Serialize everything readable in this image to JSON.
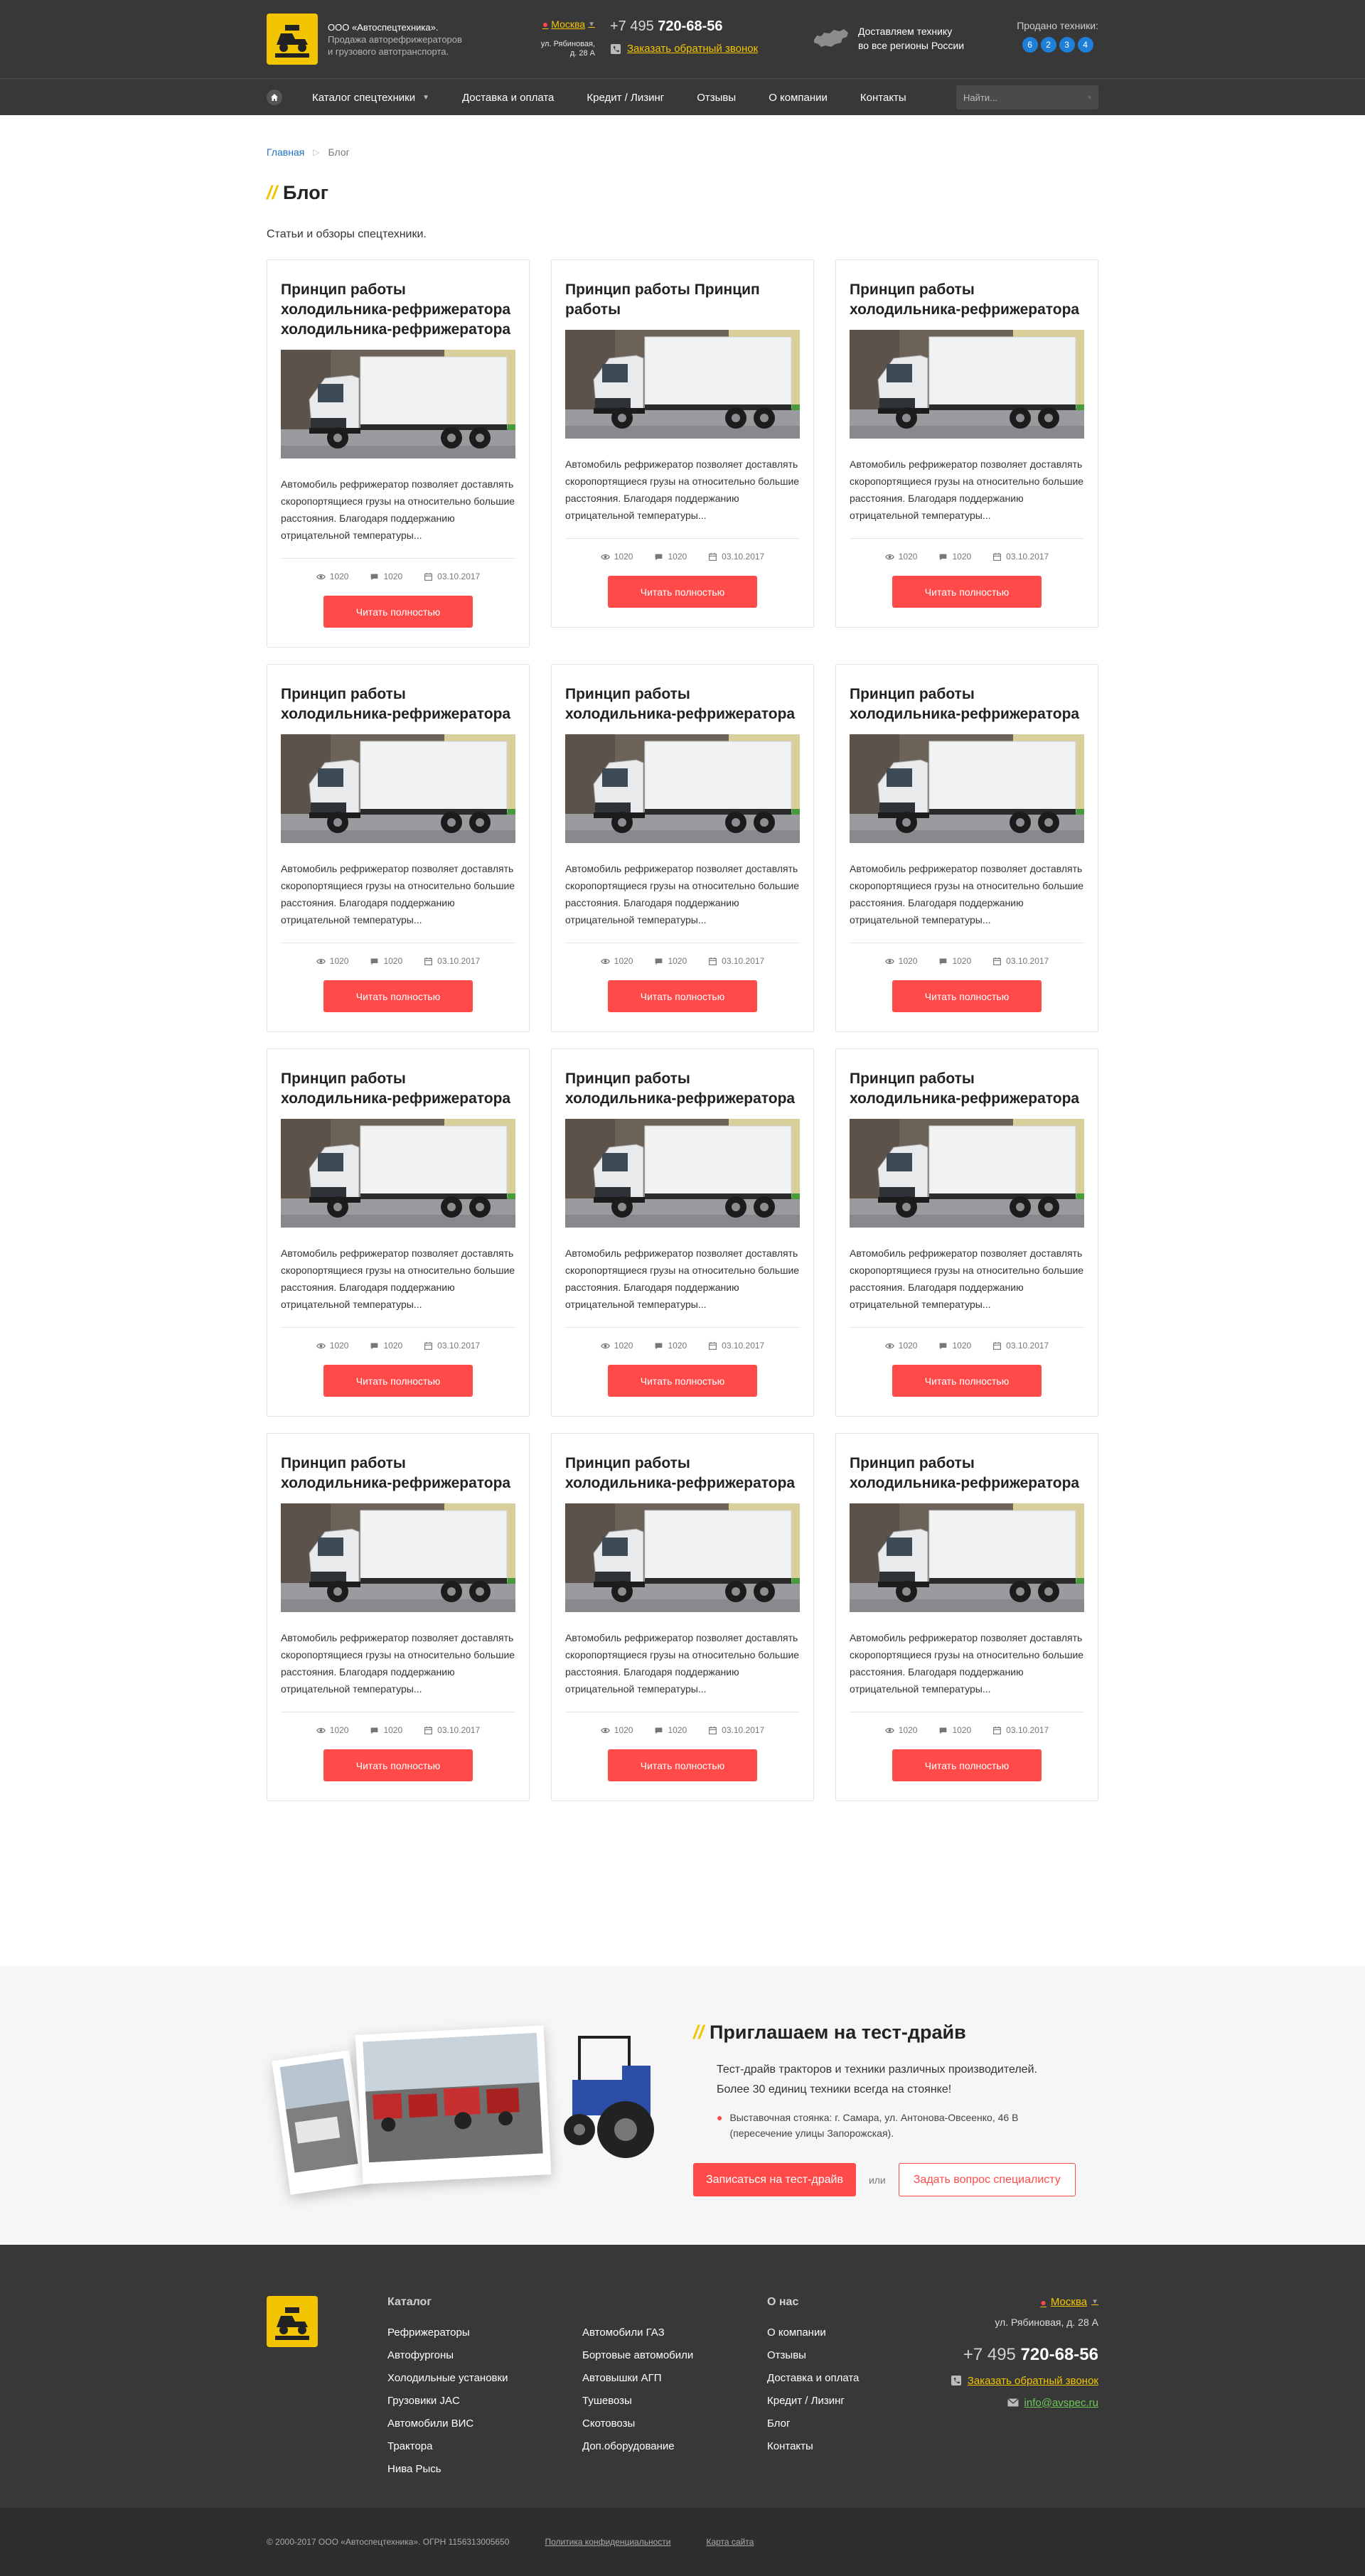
{
  "header": {
    "company_name": "ООО «Автоспецтехника».",
    "company_desc_1": "Продажа авторефрижераторов",
    "company_desc_2": "и грузового автотранспорта.",
    "city": "Москва",
    "address": "ул. Рябиновая, д. 28 А",
    "phone_code": "+7 495",
    "phone_number": "720-68-56",
    "callback": "Заказать обратный звонок",
    "delivery_1": "Доставляем технику",
    "delivery_2": "во все регионы России",
    "sold_label": "Продано техники:",
    "sold_digits": [
      "6",
      "2",
      "3",
      "4"
    ]
  },
  "nav": {
    "items": [
      "Каталог спецтехники",
      "Доставка и оплата",
      "Кредит / Лизинг",
      "Отзывы",
      "О компании",
      "Контакты"
    ],
    "search_placeholder": "Найти..."
  },
  "breadcrumb": {
    "home": "Главная",
    "current": "Блог"
  },
  "page": {
    "title": "Блог",
    "intro": "Статьи и обзоры спецтехники."
  },
  "cards": [
    {
      "title": "Принцип работы холодильника-рефрижератора холодильника-рефрижератора",
      "text": "Автомобиль рефрижератор позволяет доставлять скоропортящиеся грузы на относительно большие расстояния. Благодаря поддержанию отрицательной температуры...",
      "views": "1020",
      "comments": "1020",
      "date": "03.10.2017",
      "button": "Читать полностью"
    },
    {
      "title": "Принцип работы Принцип работы",
      "text": "Автомобиль рефрижератор позволяет доставлять скоропортящиеся грузы на относительно большие расстояния. Благодаря поддержанию отрицательной температуры...",
      "views": "1020",
      "comments": "1020",
      "date": "03.10.2017",
      "button": "Читать полностью"
    },
    {
      "title": "Принцип работы холодильника-рефрижератора",
      "text": "Автомобиль рефрижератор позволяет доставлять скоропортящиеся грузы на относительно большие расстояния. Благодаря поддержанию отрицательной температуры...",
      "views": "1020",
      "comments": "1020",
      "date": "03.10.2017",
      "button": "Читать полностью"
    },
    {
      "title": "Принцип работы холодильника-рефрижератора",
      "text": "Автомобиль рефрижератор позволяет доставлять скоропортящиеся грузы на относительно большие расстояния. Благодаря поддержанию отрицательной температуры...",
      "views": "1020",
      "comments": "1020",
      "date": "03.10.2017",
      "button": "Читать полностью"
    },
    {
      "title": "Принцип работы холодильника-рефрижератора",
      "text": "Автомобиль рефрижератор позволяет доставлять скоропортящиеся грузы на относительно большие расстояния. Благодаря поддержанию отрицательной температуры...",
      "views": "1020",
      "comments": "1020",
      "date": "03.10.2017",
      "button": "Читать полностью"
    },
    {
      "title": "Принцип работы холодильника-рефрижератора",
      "text": "Автомобиль рефрижератор позволяет доставлять скоропортящиеся грузы на относительно большие расстояния. Благодаря поддержанию отрицательной температуры...",
      "views": "1020",
      "comments": "1020",
      "date": "03.10.2017",
      "button": "Читать полностью"
    },
    {
      "title": "Принцип работы холодильника-рефрижератора",
      "text": "Автомобиль рефрижератор позволяет доставлять скоропортящиеся грузы на относительно большие расстояния. Благодаря поддержанию отрицательной температуры...",
      "views": "1020",
      "comments": "1020",
      "date": "03.10.2017",
      "button": "Читать полностью"
    },
    {
      "title": "Принцип работы холодильника-рефрижератора",
      "text": "Автомобиль рефрижератор позволяет доставлять скоропортящиеся грузы на относительно большие расстояния. Благодаря поддержанию отрицательной температуры...",
      "views": "1020",
      "comments": "1020",
      "date": "03.10.2017",
      "button": "Читать полностью"
    },
    {
      "title": "Принцип работы холодильника-рефрижератора",
      "text": "Автомобиль рефрижератор позволяет доставлять скоропортящиеся грузы на относительно большие расстояния. Благодаря поддержанию отрицательной температуры...",
      "views": "1020",
      "comments": "1020",
      "date": "03.10.2017",
      "button": "Читать полностью"
    },
    {
      "title": "Принцип работы холодильника-рефрижератора",
      "text": "Автомобиль рефрижератор позволяет доставлять скоропортящиеся грузы на относительно большие расстояния. Благодаря поддержанию отрицательной температуры...",
      "views": "1020",
      "comments": "1020",
      "date": "03.10.2017",
      "button": "Читать полностью"
    },
    {
      "title": "Принцип работы холодильника-рефрижератора",
      "text": "Автомобиль рефрижератор позволяет доставлять скоропортящиеся грузы на относительно большие расстояния. Благодаря поддержанию отрицательной температуры...",
      "views": "1020",
      "comments": "1020",
      "date": "03.10.2017",
      "button": "Читать полностью"
    },
    {
      "title": "Принцип работы холодильника-рефрижератора",
      "text": "Автомобиль рефрижератор позволяет доставлять скоропортящиеся грузы на относительно большие расстояния. Благодаря поддержанию отрицательной температуры...",
      "views": "1020",
      "comments": "1020",
      "date": "03.10.2017",
      "button": "Читать полностью"
    }
  ],
  "testdrive": {
    "title": "Приглашаем на тест-драйв",
    "text_1": "Тест-драйв тракторов и техники различных производителей.",
    "text_2": "Более 30 единиц техники всегда на стоянке!",
    "address_1": "Выставочная стоянка: г. Самара, ул. Антонова-Овсеенко, 46 В",
    "address_2": "(пересечение улицы Запорожская).",
    "btn_primary": "Записаться на тест-драйв",
    "or": "или",
    "btn_secondary": "Задать вопрос специалисту"
  },
  "footer": {
    "catalog_head": "Каталог",
    "catalog_col1": [
      "Рефрижераторы",
      "Автофургоны",
      "Холодильные установки",
      "Грузовики JAC",
      "Автомобили ВИС",
      "Трактора",
      "Нива Рысь"
    ],
    "catalog_col2": [
      "Автомобили ГАЗ",
      "Бортовые автомобили",
      "Автовышки АГП",
      "Тушевозы",
      "Скотовозы",
      "Доп.оборудование"
    ],
    "about_head": "О нас",
    "about_links": [
      "О компании",
      "Отзывы",
      "Доставка и оплата",
      "Кредит / Лизинг",
      "Блог",
      "Контакты"
    ],
    "city": "Москва",
    "address": "ул. Рябиновая, д. 28 А",
    "phone_code": "+7 495",
    "phone_number": "720-68-56",
    "callback": "Заказать обратный звонок",
    "email": "info@avspec.ru"
  },
  "bottom": {
    "copyright": "© 2000-2017 ООО «Автоспецтехника». ОГРН 1156313005650",
    "privacy": "Политика конфиденциальности",
    "sitemap": "Карта сайта"
  },
  "colors": {
    "accent": "#ff4a4a",
    "brand_yellow": "#f3c500",
    "dark": "#383838",
    "link_blue": "#1f6fbf"
  },
  "icons": [
    "home-icon",
    "map-pin-icon",
    "phone-icon",
    "russia-map-icon",
    "search-icon",
    "eye-icon",
    "comment-icon",
    "calendar-icon",
    "mail-icon"
  ]
}
